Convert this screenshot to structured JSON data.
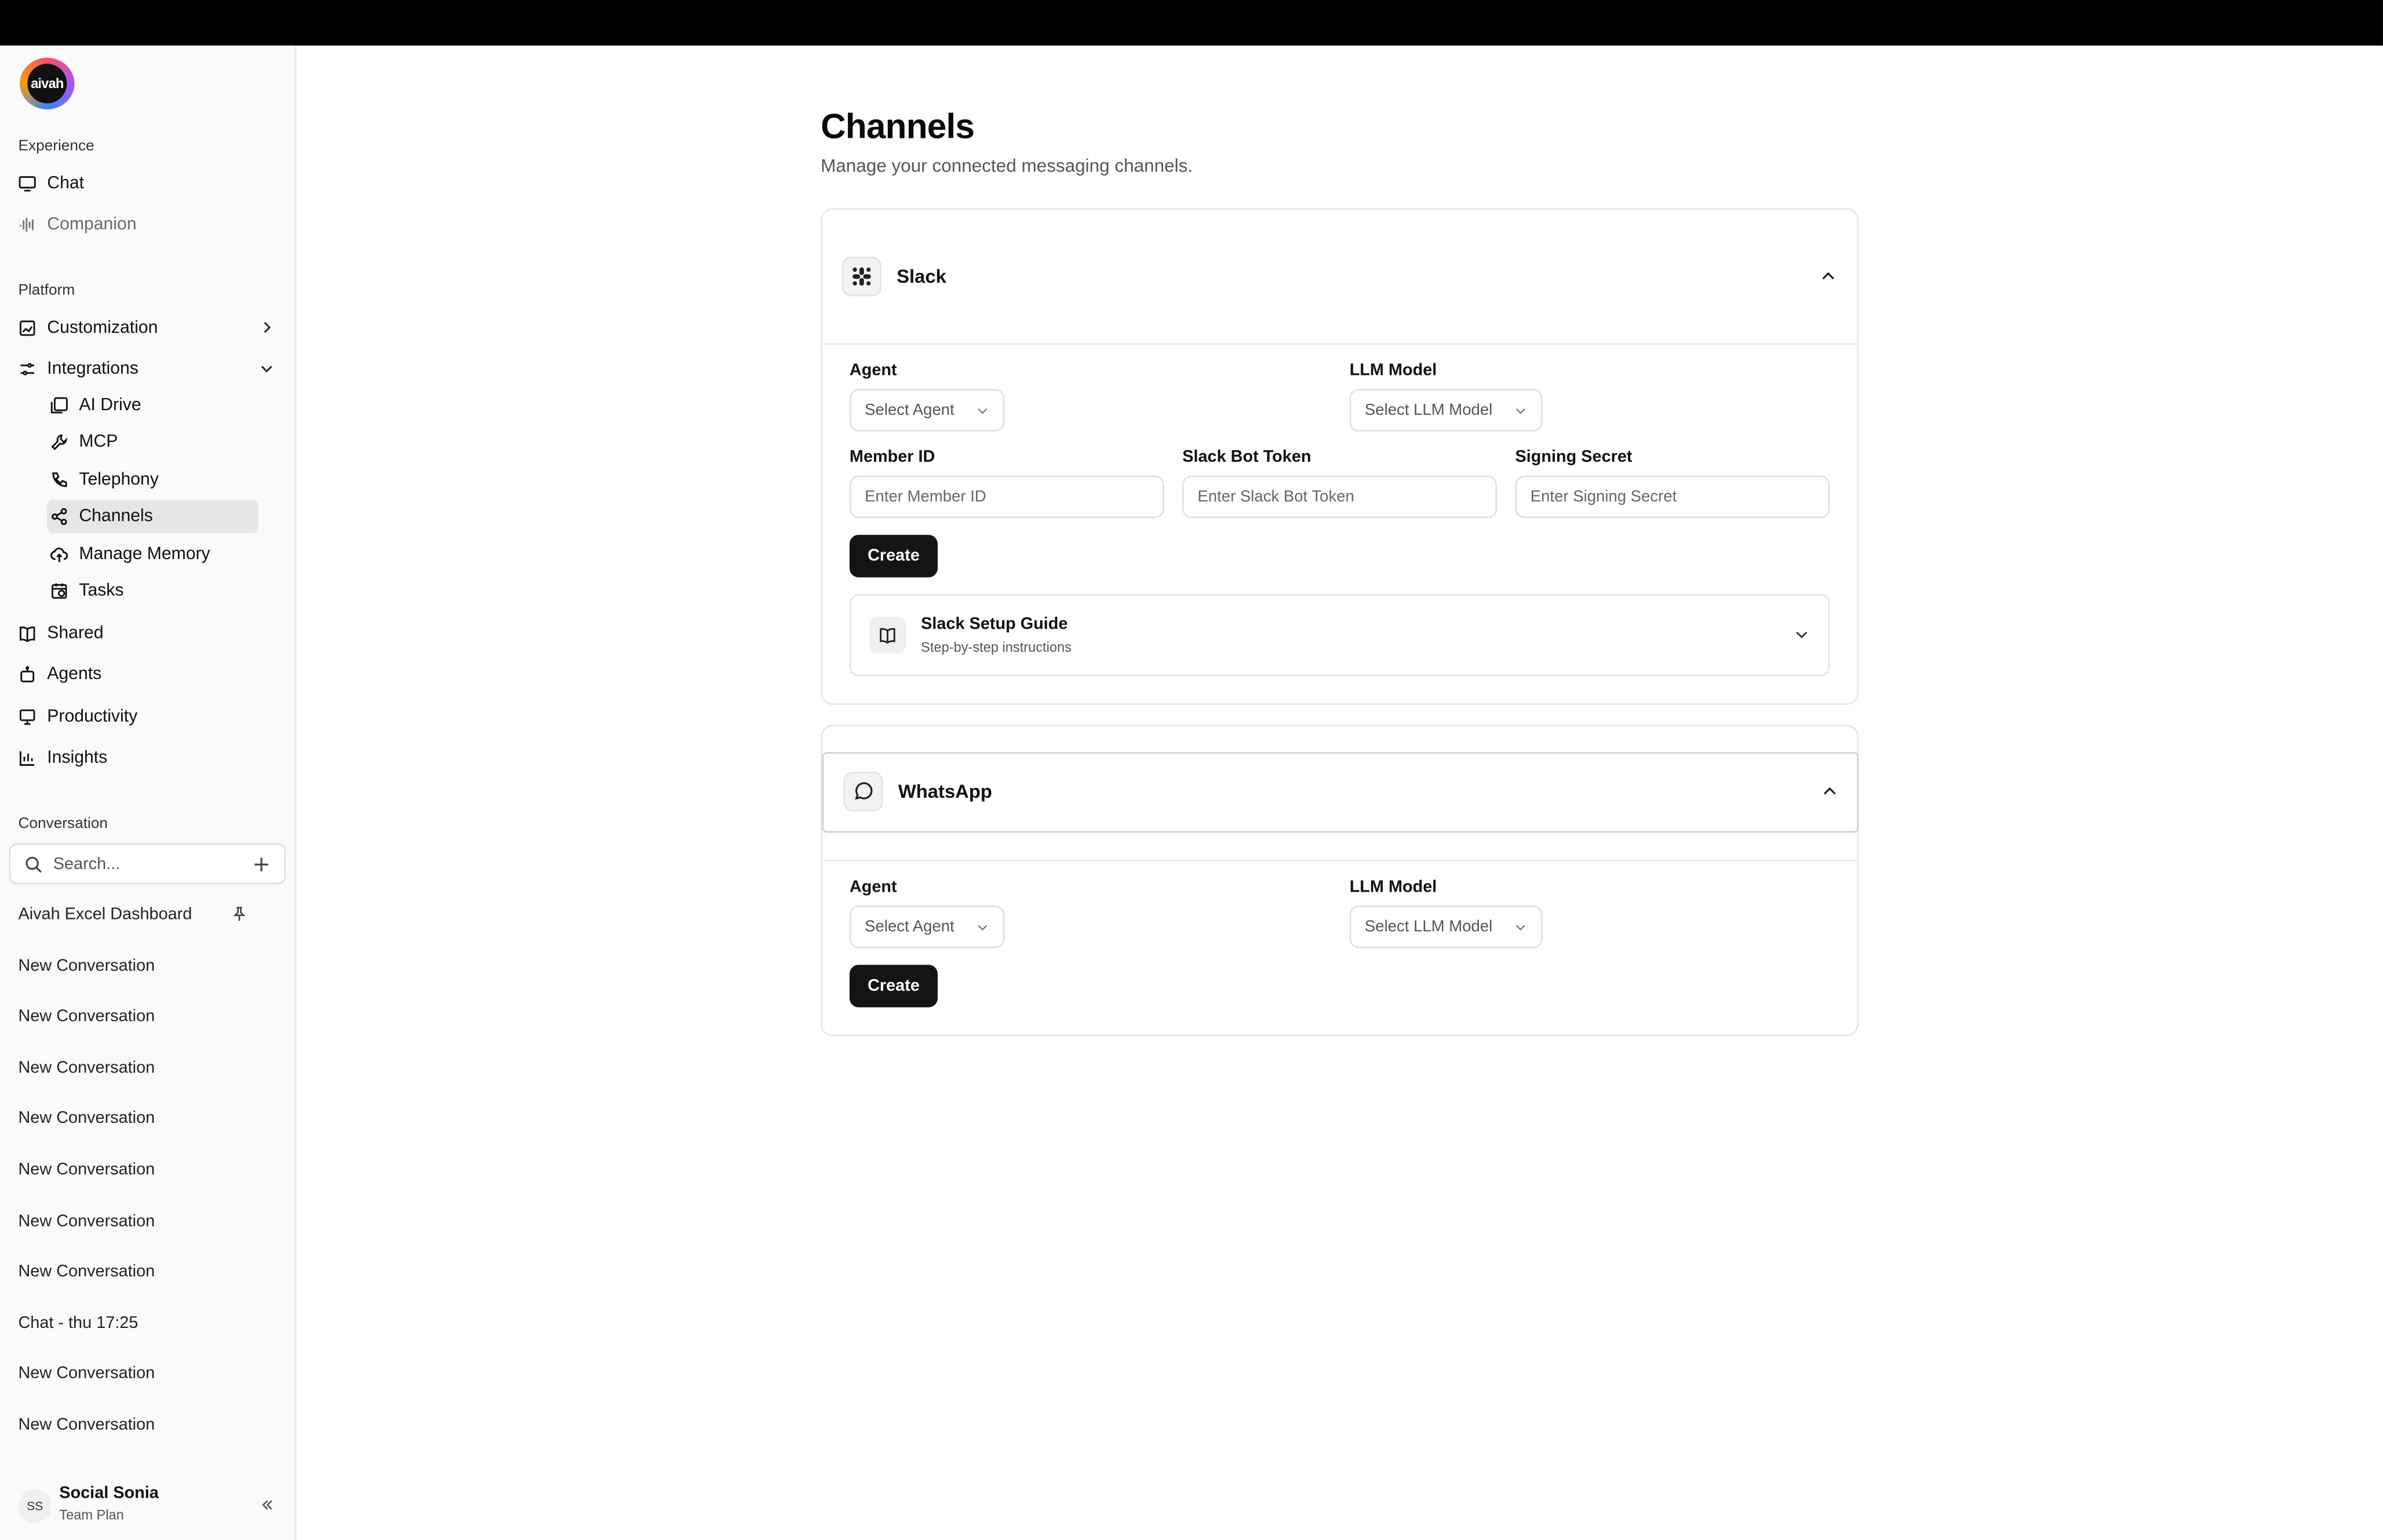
{
  "app": {
    "logo_text": "aivah"
  },
  "sidebar": {
    "experience_label": "Experience",
    "experience_items": [
      "Chat",
      "Companion"
    ],
    "platform_label": "Platform",
    "platform_items": [
      "Customization",
      "Integrations"
    ],
    "integration_items": [
      "AI Drive",
      "MCP",
      "Telephony",
      "Channels",
      "Manage Memory",
      "Tasks"
    ],
    "other_items": [
      "Shared",
      "Agents",
      "Productivity",
      "Insights"
    ],
    "conversation_label": "Conversation",
    "search_placeholder": "Search...",
    "conversations": [
      "Aivah Excel Dashboard",
      "New Conversation",
      "New Conversation",
      "New Conversation",
      "New Conversation",
      "New Conversation",
      "New Conversation",
      "New Conversation",
      "Chat - thu 17:25",
      "New Conversation",
      "New Conversation"
    ],
    "user": {
      "initials": "SS",
      "name": "Social Sonia",
      "plan": "Team Plan"
    }
  },
  "main": {
    "title": "Channels",
    "subtitle": "Manage your connected messaging channels.",
    "slack": {
      "name": "Slack",
      "agent_label": "Agent",
      "agent_placeholder": "Select Agent",
      "llm_label": "LLM Model",
      "llm_placeholder": "Select LLM Model",
      "member_id_label": "Member ID",
      "member_id_placeholder": "Enter Member ID",
      "bot_token_label": "Slack Bot Token",
      "bot_token_placeholder": "Enter Slack Bot Token",
      "signing_secret_label": "Signing Secret",
      "signing_secret_placeholder": "Enter Signing Secret",
      "create_label": "Create",
      "guide_title": "Slack Setup Guide",
      "guide_subtitle": "Step-by-step instructions"
    },
    "whatsapp": {
      "name": "WhatsApp",
      "agent_label": "Agent",
      "agent_placeholder": "Select Agent",
      "llm_label": "LLM Model",
      "llm_placeholder": "Select LLM Model",
      "create_label": "Create"
    }
  }
}
